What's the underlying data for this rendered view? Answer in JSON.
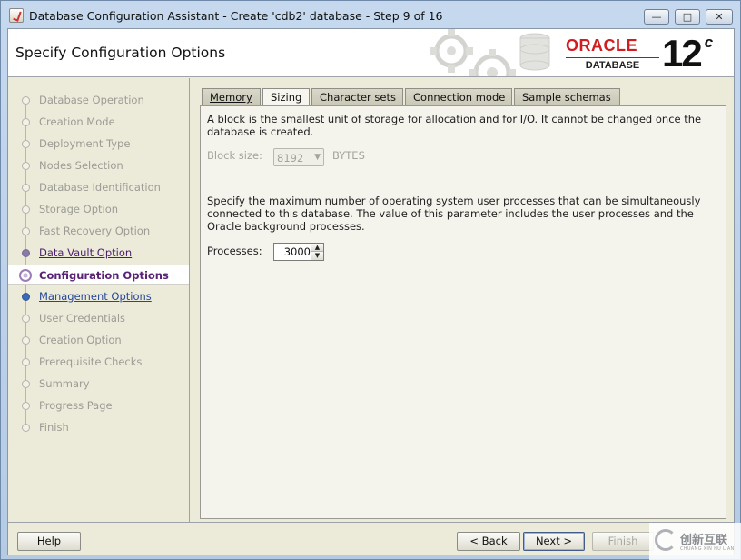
{
  "window": {
    "title": "Database Configuration Assistant - Create 'cdb2' database - Step 9 of 16",
    "minimize": "—",
    "maximize": "□",
    "close": "✕"
  },
  "header": {
    "page_title": "Specify Configuration Options",
    "logo_brand": "ORACLE",
    "logo_product": "DATABASE",
    "logo_version": "12",
    "logo_version_suffix": "c"
  },
  "steps": [
    {
      "label": "Database Operation",
      "state": "disabled"
    },
    {
      "label": "Creation Mode",
      "state": "disabled"
    },
    {
      "label": "Deployment Type",
      "state": "disabled"
    },
    {
      "label": "Nodes Selection",
      "state": "disabled"
    },
    {
      "label": "Database Identification",
      "state": "disabled"
    },
    {
      "label": "Storage Option",
      "state": "disabled"
    },
    {
      "label": "Fast Recovery Option",
      "state": "disabled"
    },
    {
      "label": "Data Vault Option",
      "state": "visited"
    },
    {
      "label": "Configuration Options",
      "state": "current"
    },
    {
      "label": "Management Options",
      "state": "next"
    },
    {
      "label": "User Credentials",
      "state": "disabled"
    },
    {
      "label": "Creation Option",
      "state": "disabled"
    },
    {
      "label": "Prerequisite Checks",
      "state": "disabled"
    },
    {
      "label": "Summary",
      "state": "disabled"
    },
    {
      "label": "Progress Page",
      "state": "disabled"
    },
    {
      "label": "Finish",
      "state": "disabled"
    }
  ],
  "tabs": [
    {
      "label": "Memory",
      "active": false
    },
    {
      "label": "Sizing",
      "active": true
    },
    {
      "label": "Character sets",
      "active": false
    },
    {
      "label": "Connection mode",
      "active": false
    },
    {
      "label": "Sample schemas",
      "active": false
    }
  ],
  "sizing": {
    "block_description": "A block is the smallest unit of storage for allocation and for I/O. It cannot be changed once the database is created.",
    "block_size_label": "Block size:",
    "block_size_value": "8192",
    "block_size_unit": "BYTES",
    "processes_description": "Specify the maximum number of operating system user processes that can be simultaneously connected to this database. The value of this parameter includes the user processes and the Oracle background processes.",
    "processes_label": "Processes:",
    "processes_value": "3000"
  },
  "buttons": {
    "help": "Help",
    "back": "< Back",
    "next": "Next >",
    "finish": "Finish"
  },
  "watermark": {
    "text": "创新互联",
    "subtext": "CHUANG XIN HU LIAN"
  },
  "colors": {
    "oracle_red": "#d01d20",
    "current_step": "#5a2275",
    "link_blue": "#23479a",
    "panel_bg": "#ecead9"
  }
}
